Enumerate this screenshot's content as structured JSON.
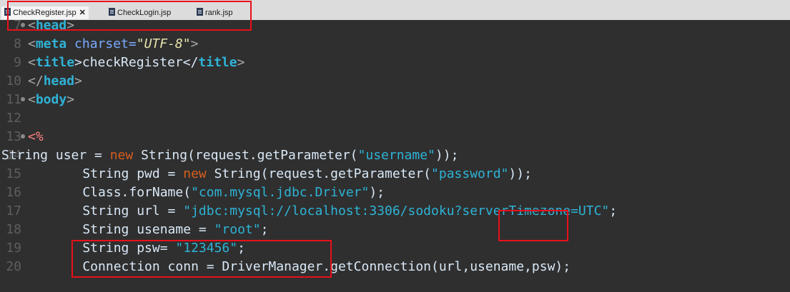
{
  "tabs": [
    {
      "label": "CheckRegister.jsp",
      "active": true,
      "close": "✕"
    },
    {
      "label": "CheckLogin.jsp",
      "active": false
    },
    {
      "label": "rank.jsp",
      "active": false
    }
  ],
  "lines": [
    {
      "n": "7",
      "t1": "<",
      "tag": "head",
      "t2": ">"
    },
    {
      "n": "8",
      "t1": "<",
      "tag": "meta",
      "attr": " charset=",
      "val": "\"UTF-8\"",
      "t2": ">"
    },
    {
      "n": "9",
      "t1": "<",
      "tag": "title",
      "text": ">checkRegister</",
      "tag2": "title",
      "t2": ">"
    },
    {
      "n": "10",
      "t1": "</",
      "tag": "head",
      "t2": ">"
    },
    {
      "n": "11",
      "t1": "<",
      "tag": "body",
      "t2": ">"
    },
    {
      "n": "12"
    },
    {
      "n": "13",
      "pct": "<%"
    },
    {
      "n": "14",
      "a": "String user = ",
      "kw": "new",
      "b": " String(request.getParameter(",
      "s": "\"username\"",
      "c": "));"
    },
    {
      "n": "15",
      "a": "    String pwd = ",
      "kw": "new",
      "b": " String(request.getParameter(",
      "s": "\"password\"",
      "c": "));"
    },
    {
      "n": "16",
      "a": "    Class.forName(",
      "s": "\"com.mysql.jdbc.Driver\"",
      "c": ");"
    },
    {
      "n": "17",
      "a": "    String url = ",
      "s": "\"jdbc:mysql://localhost:3306/sodoku?serverTimezone=UTC\"",
      "c": ";"
    },
    {
      "n": "18",
      "a": "    String usename = ",
      "s": "\"root\"",
      "c": ";"
    },
    {
      "n": "19",
      "a": "    String psw= ",
      "s": "\"123456\"",
      "c": ";"
    },
    {
      "n": "20",
      "a": "    Connection conn = DriverManager.getConnection(url,usename,psw);"
    }
  ]
}
